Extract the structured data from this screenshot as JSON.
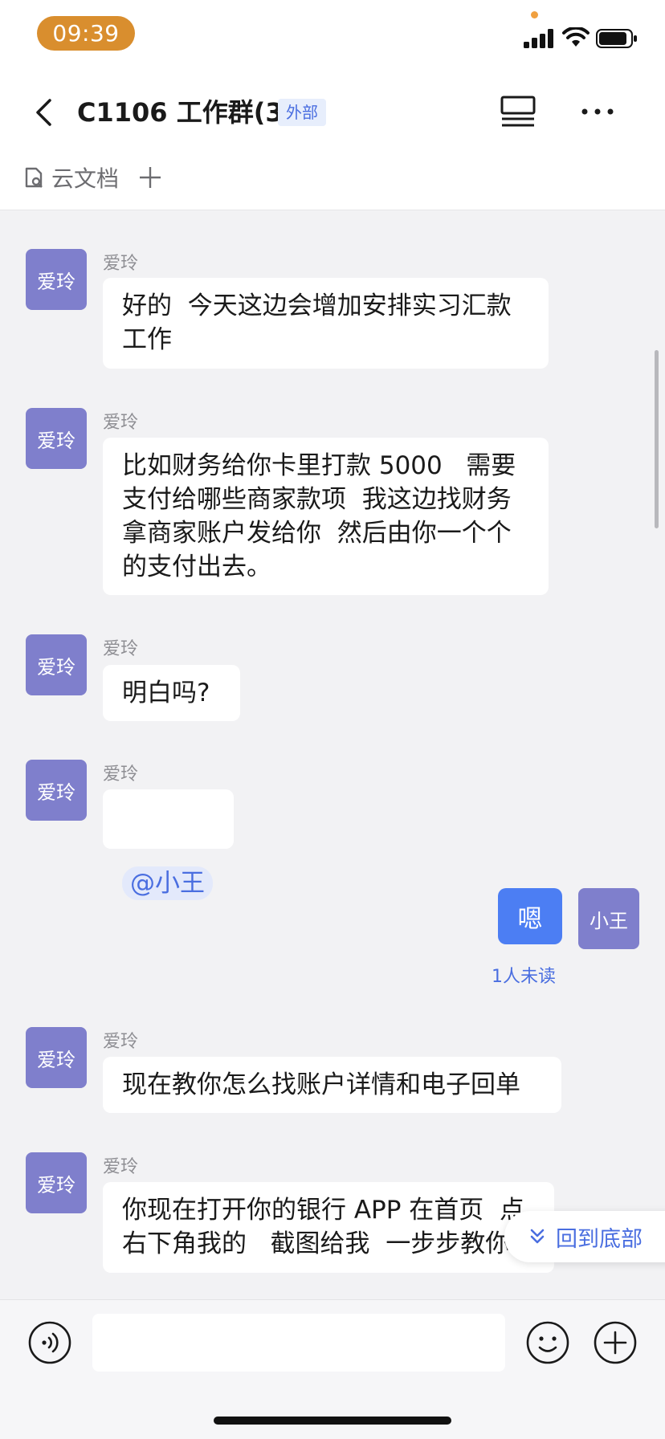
{
  "status_bar": {
    "time": "09:39"
  },
  "header": {
    "title": "C1106 工作群(3)",
    "tag": "外部",
    "back_icon": "chevron-left-icon",
    "layout_icon": "list-layout-icon",
    "more_icon": "more-icon"
  },
  "docs_row": {
    "label": "云文档",
    "add_icon": "plus-icon"
  },
  "messages": [
    {
      "sender": "爱玲",
      "avatar": "爱玲",
      "text": "好的  今天这边会增加安排实习汇款\n工作"
    },
    {
      "sender": "爱玲",
      "avatar": "爱玲",
      "text": "比如财务给你卡里打款 5000   需要\n支付给哪些商家款项  我这边找财务\n拿商家账户发给你  然后由你一个个\n的支付出去。"
    },
    {
      "sender": "爱玲",
      "avatar": "爱玲",
      "text": "明白吗?"
    },
    {
      "sender": "爱玲",
      "avatar": "爱玲",
      "mention": "@小王"
    },
    {
      "sender": "小王",
      "avatar": "小王",
      "text": "嗯",
      "self": true,
      "read_status": "1人未读"
    },
    {
      "sender": "爱玲",
      "avatar": "爱玲",
      "text": "现在教你怎么找账户详情和电子回单"
    },
    {
      "sender": "爱玲",
      "avatar": "爱玲",
      "text": "你现在打开你的银行 APP 在首页  点\n右下角我的   截图给我  一步步教你"
    }
  ],
  "jump_to_bottom": {
    "label": "回到底部",
    "icon": "double-chevron-down-icon"
  },
  "input_bar": {
    "placeholder": "",
    "voice_icon": "voice-icon",
    "emoji_icon": "emoji-icon",
    "plus_icon": "plus-circle-icon"
  },
  "colors": {
    "accent": "#4c7ef3",
    "avatar_bg": "#7f7fcc",
    "time_pill": "#d98e2e",
    "tag_text": "#4a6ee0"
  }
}
